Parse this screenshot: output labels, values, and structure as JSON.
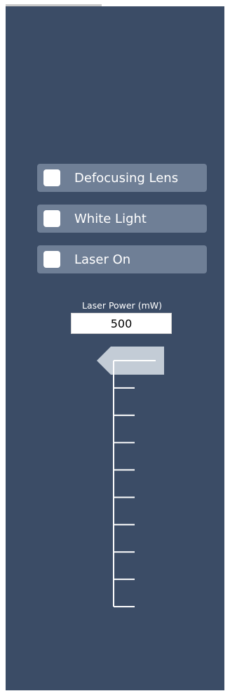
{
  "options": [
    {
      "label": "Defocusing Lens",
      "checked": false
    },
    {
      "label": "White Light",
      "checked": false
    },
    {
      "label": "Laser On",
      "checked": false
    }
  ],
  "laser_power": {
    "label": "Laser Power (mW)",
    "value": "500",
    "slider_level": 1.0
  },
  "colors": {
    "panel": "#3b4c66",
    "toggle_bg": "#6f7f96",
    "thumb": "#c3ccd6",
    "ticks": "#ffffff"
  }
}
